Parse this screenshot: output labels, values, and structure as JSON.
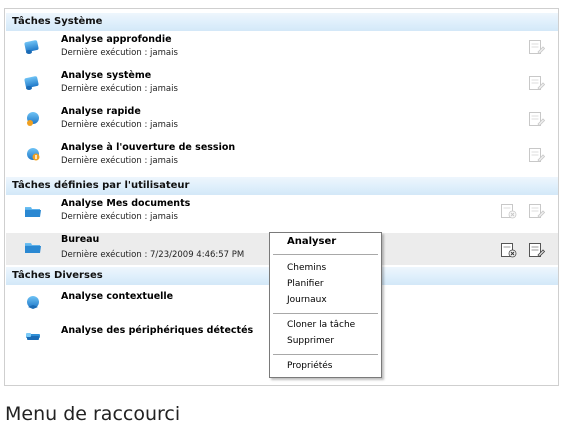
{
  "sections": {
    "system": "Tâches Système",
    "user": "Tâches définies par l'utilisateur",
    "misc": "Tâches Diverses"
  },
  "tasks": {
    "deep_scan": {
      "name": "Analyse approfondie",
      "last_run": "Dernière exécution : jamais"
    },
    "system_scan": {
      "name": "Analyse système",
      "last_run": "Dernière exécution : jamais"
    },
    "quick_scan": {
      "name": "Analyse rapide",
      "last_run": "Dernière exécution : jamais"
    },
    "logon_scan": {
      "name": "Analyse à l'ouverture de session",
      "last_run": "Dernière exécution : jamais"
    },
    "my_documents": {
      "name": "Analyse Mes documents",
      "last_run": "Dernière exécution : jamais"
    },
    "desktop": {
      "name": "Bureau",
      "last_run": "Dernière exécution : 7/23/2009 4:46:57 PM"
    },
    "contextual": {
      "name": "Analyse contextuelle"
    },
    "detected_devices": {
      "name": "Analyse des périphériques détectés"
    }
  },
  "context_menu": {
    "scan": "Analyser",
    "paths": "Chemins",
    "schedule": "Planifier",
    "logs": "Journaux",
    "clone": "Cloner la tâche",
    "delete": "Supprimer",
    "properties": "Propriétés"
  },
  "caption": "Menu de raccourci",
  "icons": {
    "task_monitor": "monitor-scan-icon",
    "task_globe": "globe-scan-icon",
    "task_folder": "folder-scan-icon",
    "task_key": "usb-device-icon",
    "edit": "edit-task-icon",
    "delete": "delete-task-icon"
  },
  "colors": {
    "section_header_bg": "#ddeefb",
    "selected_row_bg": "#ececec",
    "icon_blue": "#2f8fd6",
    "icon_orange": "#f0a020"
  }
}
